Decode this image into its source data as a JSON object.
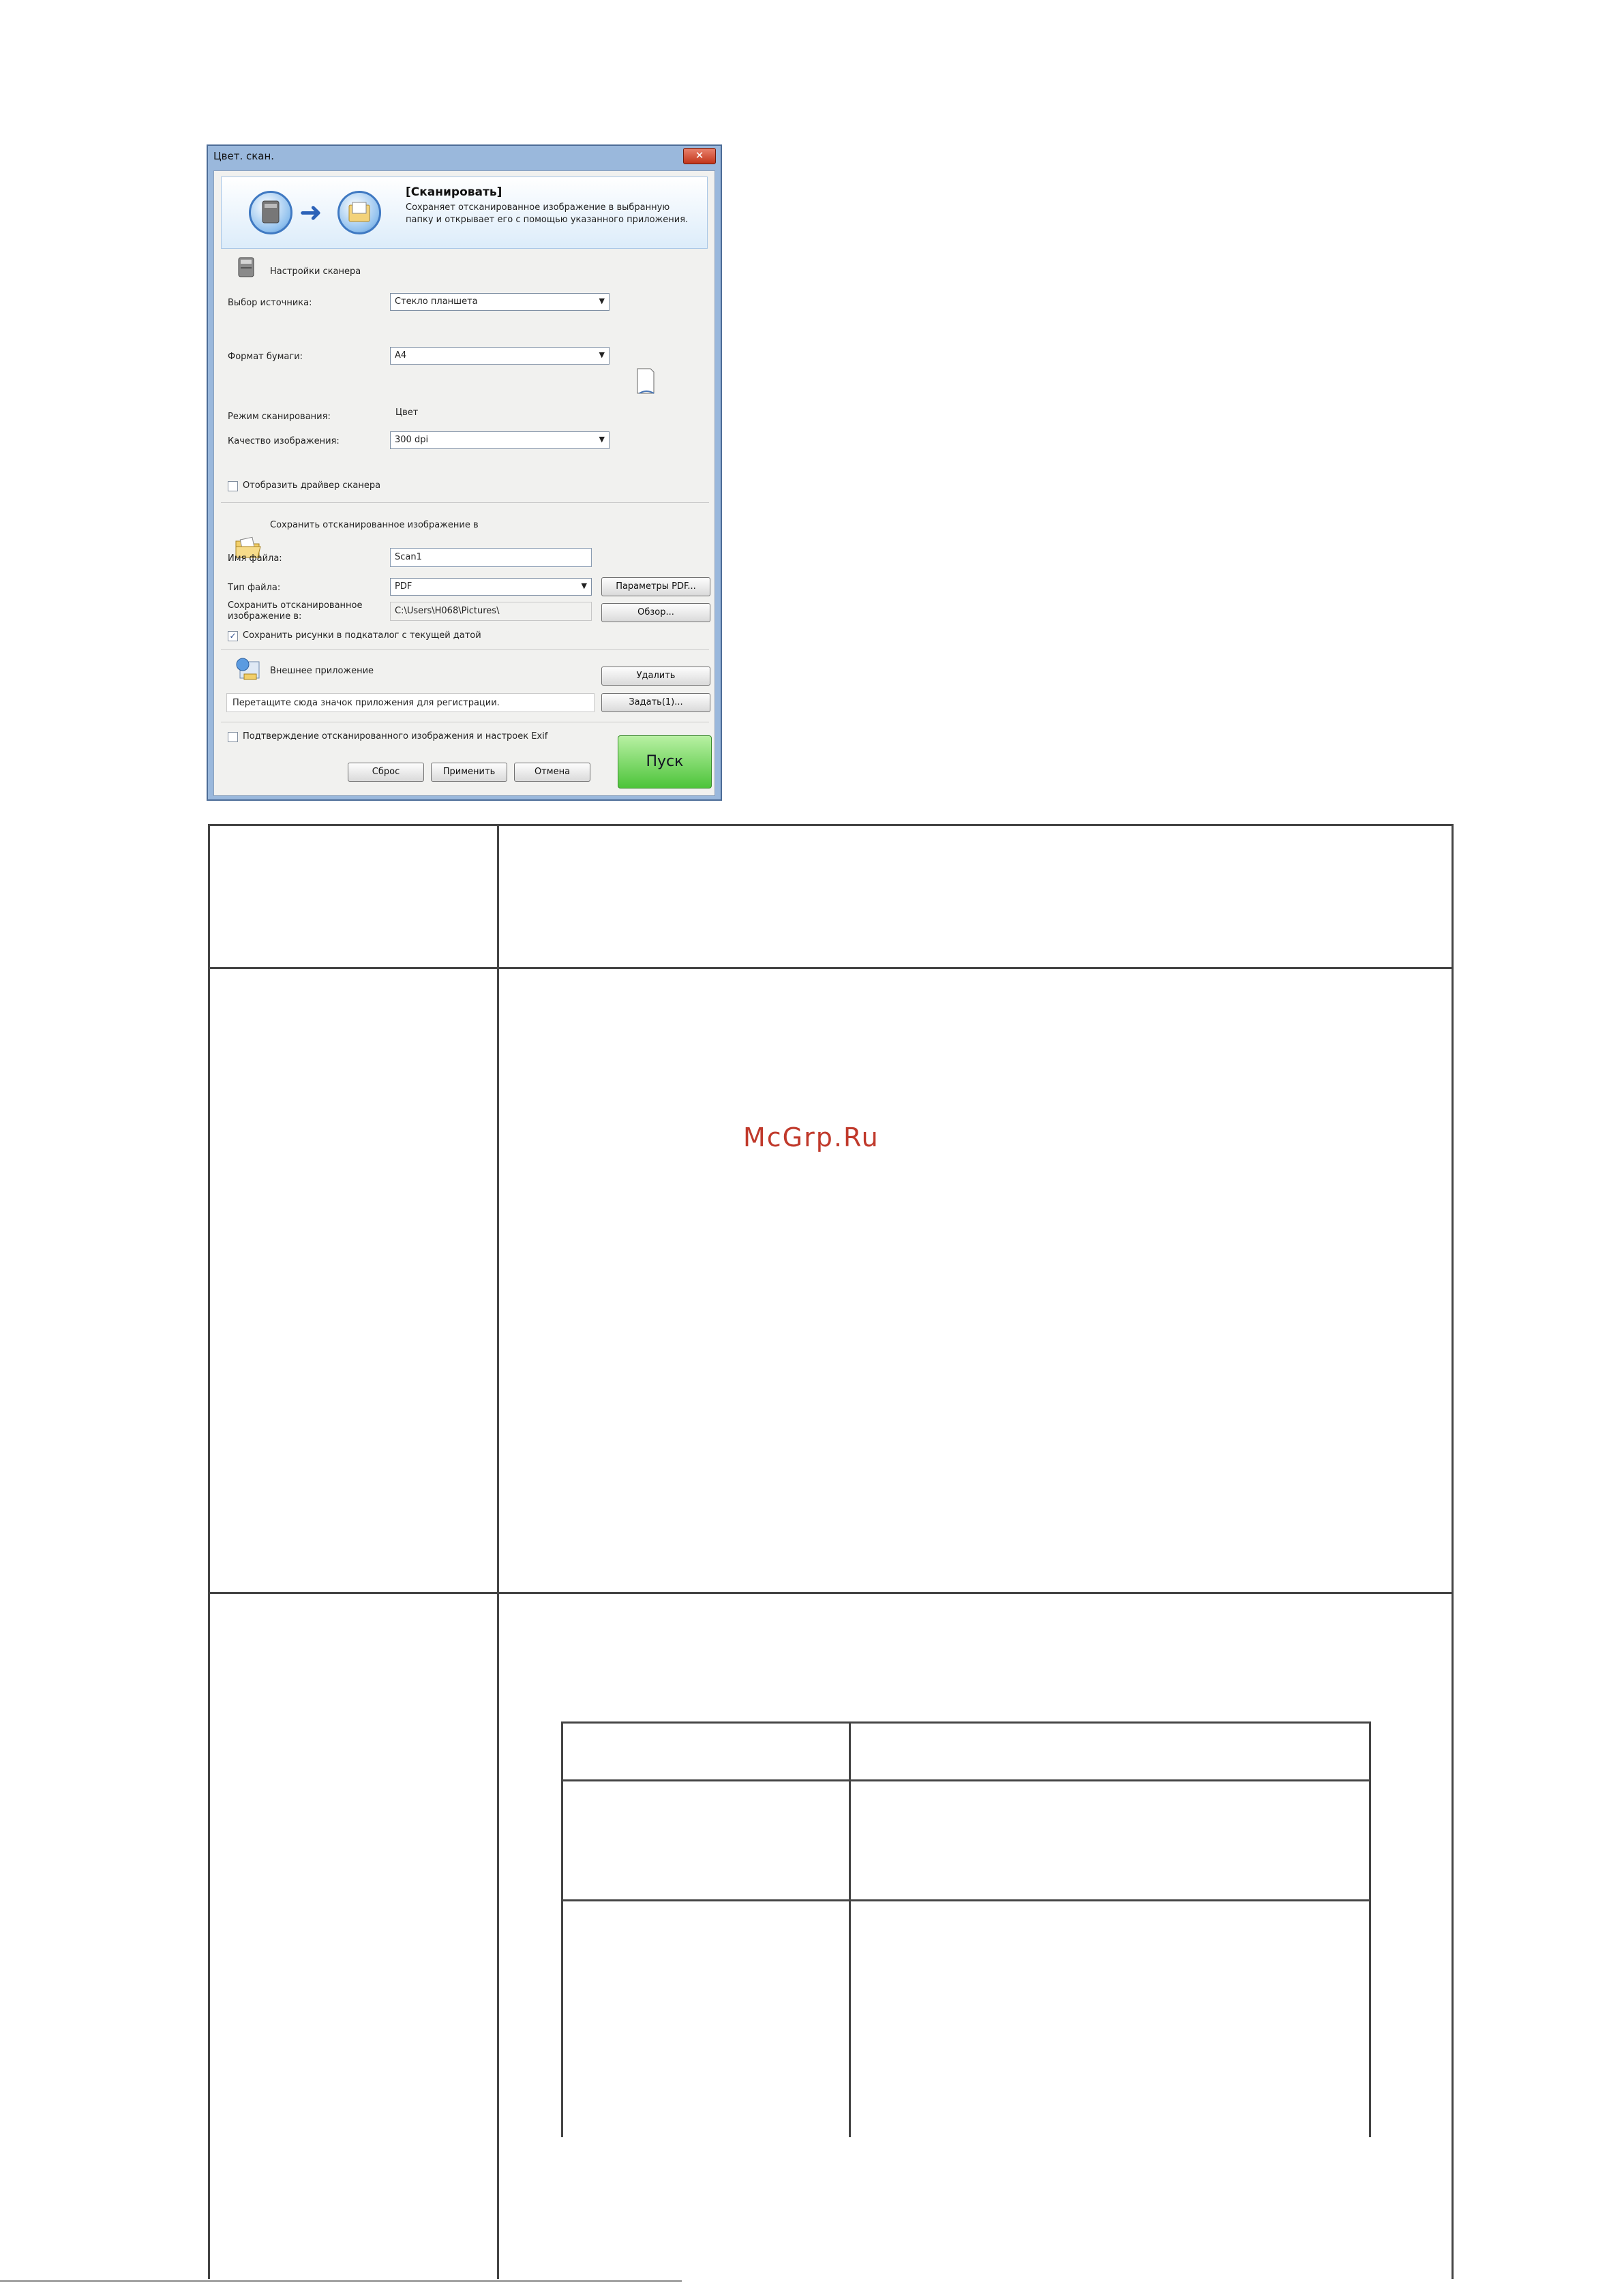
{
  "window": {
    "title": "Цвет. скан.",
    "close_glyph": "✕"
  },
  "banner": {
    "title": "[Сканировать]",
    "description": "Сохраняет отсканированное изображение в выбранную папку и открывает его с помощью указанного приложения."
  },
  "scanner_settings": {
    "heading": "Настройки сканера",
    "source_label": "Выбор источника:",
    "source_value": "Стекло планшета",
    "paper_label": "Формат бумаги:",
    "paper_value": "A4",
    "mode_label": "Режим сканирования:",
    "mode_value": "Цвет",
    "quality_label": "Качество изображения:",
    "quality_value": "300 dpi",
    "show_driver_label": "Отобразить драйвер сканера",
    "show_driver_checked": false
  },
  "save_settings": {
    "heading": "Сохранить отсканированное изображение в",
    "filename_label": "Имя файла:",
    "filename_value": "Scan1",
    "filetype_label": "Тип файла:",
    "filetype_value": "PDF",
    "pdf_settings_button": "Параметры PDF...",
    "save_in_label": "Сохранить отсканированное изображение в:",
    "save_in_value": "C:\\Users\\H068\\Pictures\\",
    "browse_button": "Обзор...",
    "subfolder_label": "Сохранить рисунки в подкаталог с текущей датой",
    "subfolder_checked": true
  },
  "external_app": {
    "heading": "Внешнее приложение",
    "delete_button": "Удалить",
    "drag_hint": "Перетащите сюда значок приложения для регистрации.",
    "set_button": "Задать(1)..."
  },
  "footer": {
    "confirm_label": "Подтверждение отсканированного изображения и настроек Exif",
    "confirm_checked": false,
    "reset_button": "Сброс",
    "apply_button": "Применить",
    "cancel_button": "Отмена",
    "start_button": "Пуск"
  },
  "watermark": "McGrp.Ru",
  "colors": {
    "start_button": "#4dc43a",
    "watermark": "#c0392b",
    "window_frame": "#9ab8dc"
  },
  "icons": [
    "scanner-icon",
    "folder-icon",
    "application-icon",
    "paper-icon",
    "arrow-right-icon",
    "close-icon",
    "dropdown-arrow-icon"
  ]
}
